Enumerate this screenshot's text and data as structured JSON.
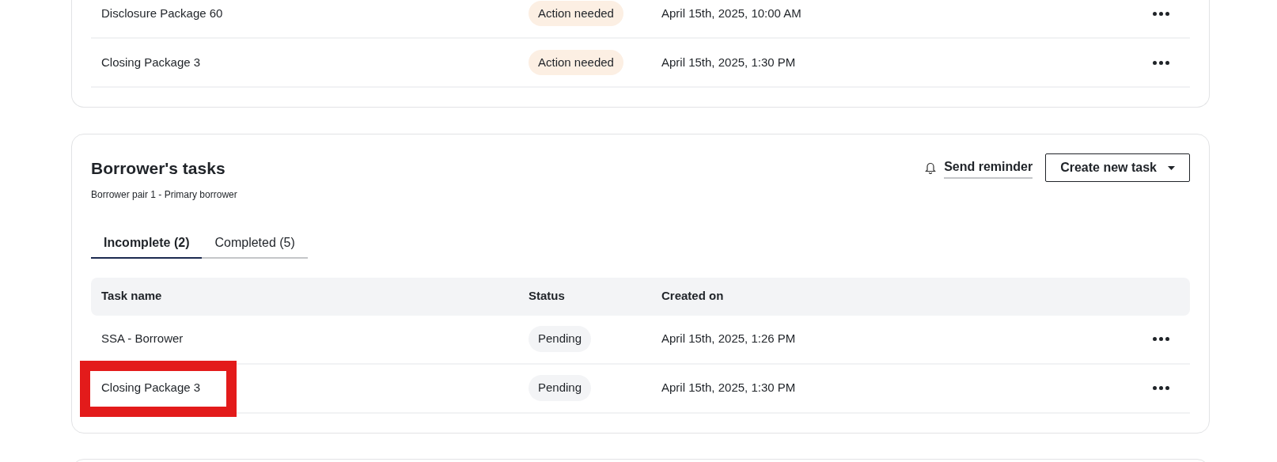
{
  "previous_tasks": {
    "rows": [
      {
        "name": "Disclosure Package 60",
        "status": "Action needed",
        "color": "#fcefe3",
        "created_on": "April 15th, 2025, 10:00 AM",
        "highlighted": false
      },
      {
        "name": "Closing Package 3",
        "status": "Action needed",
        "color": "#fcefe3",
        "created_on": "April 15th, 2025, 1:30 PM",
        "highlighted": false
      }
    ]
  },
  "borrower_tasks": {
    "title": "Borrower's tasks",
    "subtitle": "Borrower pair 1 - Primary borrower",
    "send_reminder": "Send reminder",
    "create_button": "Create new task",
    "tabs": [
      {
        "label": "Incomplete (2)",
        "selected": true
      },
      {
        "label": "Completed (5)",
        "selected": false
      }
    ],
    "columns": [
      "Task name",
      "Status",
      "Created on"
    ],
    "rows": [
      {
        "name": "SSA - Borrower",
        "status": "Pending",
        "color": "#f3f4f6",
        "created_on": "April 15th, 2025, 1:26 PM",
        "highlighted": false
      },
      {
        "name": "Closing Package 3",
        "status": "Pending",
        "color": "#f3f4f6",
        "created_on": "April 15th, 2025, 1:30 PM",
        "highlighted": true
      }
    ]
  }
}
